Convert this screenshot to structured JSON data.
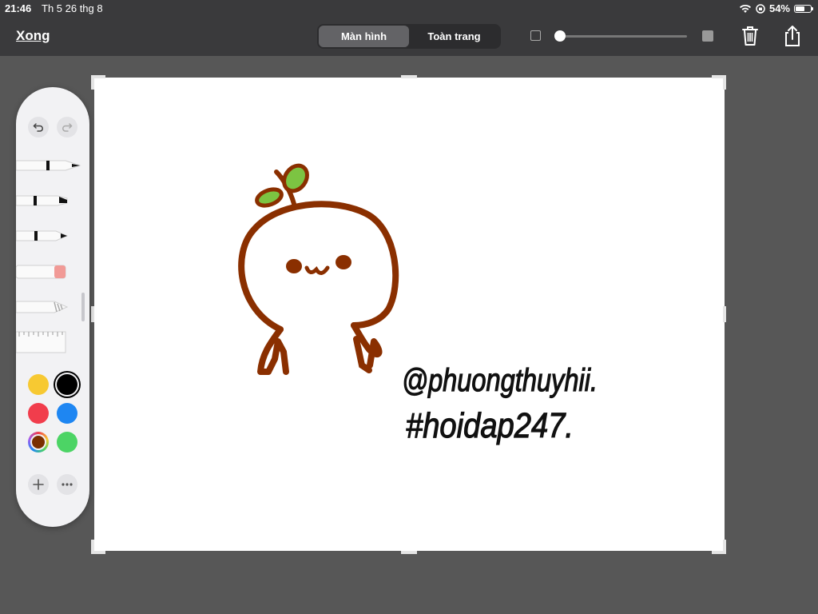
{
  "status_bar": {
    "time": "21:46",
    "date": "Th 5 26 thg 8",
    "battery": "54%",
    "battery_level": 0.54
  },
  "toolbar": {
    "done_label": "Xong",
    "tabs": [
      {
        "label": "Màn hình",
        "active": true
      },
      {
        "label": "Toàn trang",
        "active": false
      }
    ],
    "icons": [
      "trash-icon",
      "share-icon"
    ]
  },
  "drawing": {
    "handle_line1": "@phuongthuyhii.",
    "handle_line2": "#hoidap247."
  },
  "palette": {
    "colors": {
      "yellow": "#f7c932",
      "black": "#000000",
      "red": "#f13d4c",
      "blue": "#1e86f2",
      "custom": "#7a2f00",
      "green": "#4cd465"
    },
    "tools": [
      "pen",
      "marker",
      "pencil",
      "eraser",
      "lasso",
      "ruler"
    ]
  },
  "theme": {
    "toolbar_bg": "#3a3a3c",
    "workspace_bg": "#575757",
    "stroke_brown": "#8a2f00",
    "sprout_green": "#7cc442"
  }
}
